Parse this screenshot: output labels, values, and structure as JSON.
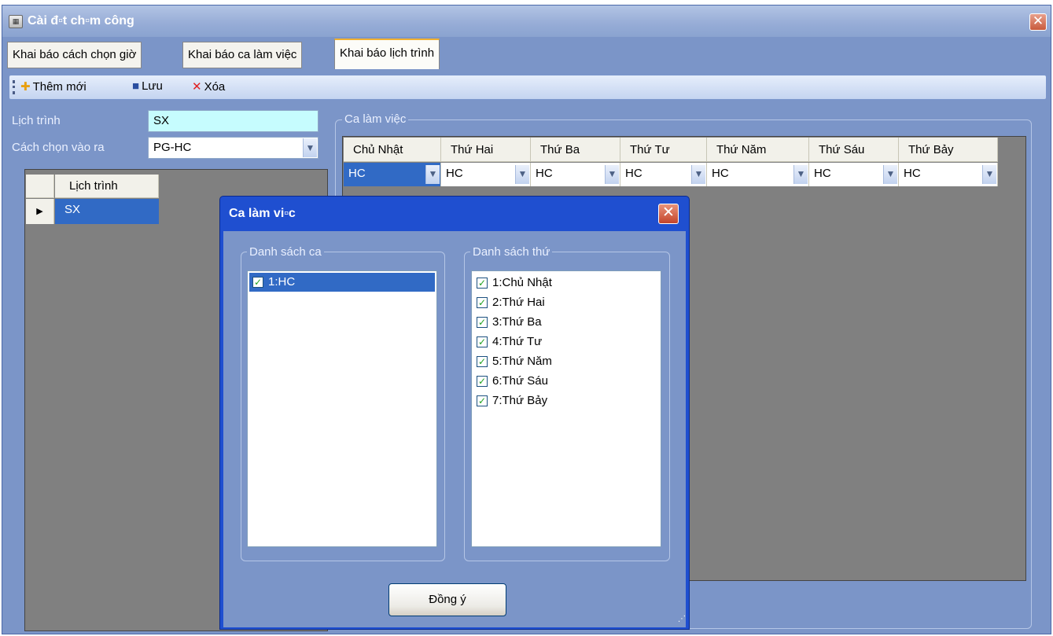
{
  "window": {
    "title": "Cài đ▫t ch▫m công",
    "icon": "app-icon",
    "close_label": "✕"
  },
  "tabs": [
    {
      "label": "Khai báo cách chọn giờ"
    },
    {
      "label": "Khai báo ca làm việc"
    },
    {
      "label": "Khai báo lịch trình"
    }
  ],
  "toolbar": {
    "add_label": "Thêm mới",
    "save_label": "Lưu",
    "delete_label": "Xóa",
    "add_icon": "plus-icon",
    "save_icon": "floppy-disk-icon",
    "delete_icon": "red-x-icon"
  },
  "form": {
    "schedule_label": "Lịch trình",
    "schedule_value": "SX",
    "inout_label": "Cách chọn vào ra",
    "inout_value": "PG-HC"
  },
  "left_grid": {
    "header": "Lịch trình",
    "rows": [
      {
        "marker": "▶",
        "value": "SX"
      }
    ]
  },
  "shift_group": {
    "title": "Ca làm việc",
    "columns": [
      "Chủ Nhật",
      "Thứ Hai",
      "Thứ Ba",
      "Thứ Tư",
      "Thứ Năm",
      "Thứ Sáu",
      "Thứ Bảy"
    ],
    "values": [
      "HC",
      "HC",
      "HC",
      "HC",
      "HC",
      "HC",
      "HC"
    ]
  },
  "dialog": {
    "title": "Ca làm vi▫c",
    "shift_list_title": "Danh sách ca",
    "shift_items": [
      {
        "label": "1:HC",
        "checked": true
      }
    ],
    "day_list_title": "Danh sách thứ",
    "day_items": [
      {
        "label": "1:Chủ Nhật",
        "checked": true
      },
      {
        "label": "2:Thứ Hai",
        "checked": true
      },
      {
        "label": "3:Thứ Ba",
        "checked": true
      },
      {
        "label": "4:Thứ Tư",
        "checked": true
      },
      {
        "label": "5:Thứ Năm",
        "checked": true
      },
      {
        "label": "6:Thứ Sáu",
        "checked": true
      },
      {
        "label": "7:Thứ Bảy",
        "checked": true
      }
    ],
    "ok_label": "Đồng ý"
  },
  "colors": {
    "window_bg": "#7b95c8",
    "dialog_frame": "#1f4fd0",
    "selection": "#316ac5",
    "cyan_field": "#c6fcfe",
    "grid_bg": "#808080"
  }
}
